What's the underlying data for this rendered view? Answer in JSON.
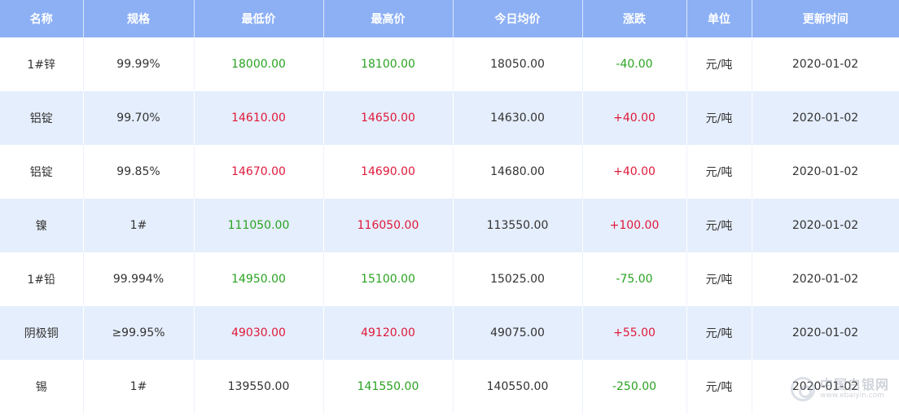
{
  "colors": {
    "header_bg": "#8db0f5",
    "row_alt_bg": "#e5eefc",
    "up": "#e0193b",
    "down": "#2aa321"
  },
  "headers": [
    "名称",
    "规格",
    "最低价",
    "最高价",
    "今日均价",
    "涨跌",
    "单位",
    "更新时间"
  ],
  "rows": [
    {
      "name": "1#锌",
      "spec": "99.99%",
      "low": "18000.00",
      "low_trend": "down",
      "high": "18100.00",
      "high_trend": "down",
      "avg": "18050.00",
      "change": "-40.00",
      "change_trend": "down",
      "unit": "元/吨",
      "updated": "2020-01-02"
    },
    {
      "name": "铝锭",
      "spec": "99.70%",
      "low": "14610.00",
      "low_trend": "up",
      "high": "14650.00",
      "high_trend": "up",
      "avg": "14630.00",
      "change": "+40.00",
      "change_trend": "up",
      "unit": "元/吨",
      "updated": "2020-01-02"
    },
    {
      "name": "铝锭",
      "spec": "99.85%",
      "low": "14670.00",
      "low_trend": "up",
      "high": "14690.00",
      "high_trend": "up",
      "avg": "14680.00",
      "change": "+40.00",
      "change_trend": "up",
      "unit": "元/吨",
      "updated": "2020-01-02"
    },
    {
      "name": "镍",
      "spec": "1#",
      "low": "111050.00",
      "low_trend": "down",
      "high": "116050.00",
      "high_trend": "up",
      "avg": "113550.00",
      "change": "+100.00",
      "change_trend": "up",
      "unit": "元/吨",
      "updated": "2020-01-02"
    },
    {
      "name": "1#铅",
      "spec": "99.994%",
      "low": "14950.00",
      "low_trend": "down",
      "high": "15100.00",
      "high_trend": "down",
      "avg": "15025.00",
      "change": "-75.00",
      "change_trend": "down",
      "unit": "元/吨",
      "updated": "2020-01-02"
    },
    {
      "name": "阴极铜",
      "spec": "≥99.95%",
      "low": "49030.00",
      "low_trend": "up",
      "high": "49120.00",
      "high_trend": "up",
      "avg": "49075.00",
      "change": "+55.00",
      "change_trend": "up",
      "unit": "元/吨",
      "updated": "2020-01-02"
    },
    {
      "name": "锡",
      "spec": "1#",
      "low": "139550.00",
      "low_trend": "flat",
      "high": "141550.00",
      "high_trend": "down",
      "avg": "140550.00",
      "change": "-250.00",
      "change_trend": "down",
      "unit": "元/吨",
      "updated": "2020-01-02"
    }
  ],
  "watermark": {
    "name": "中国白银网",
    "url": "www.ebaiyin.com",
    "icon": "logo-ring-icon"
  }
}
